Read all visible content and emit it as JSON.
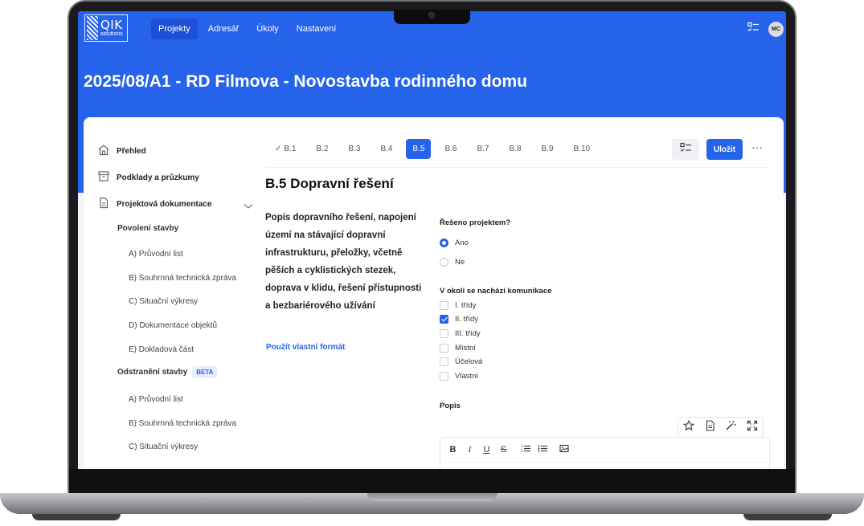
{
  "app": {
    "logo_text": "QIK",
    "logo_sub": "solutions",
    "nav": [
      "Projekty",
      "Adresář",
      "Úkoly",
      "Nastavení"
    ],
    "active_nav": "Projekty",
    "user_initials": "MC"
  },
  "page": {
    "title": "2025/08/A1 - RD Filmova - Novostavba rodinného domu"
  },
  "sidebar": {
    "overview": "Přehled",
    "docs": "Podklady a průzkumy",
    "project_docs": "Projektová dokumentace",
    "permit": "Povolení stavby",
    "permit_items": [
      "A) Průvodní list",
      "B) Souhrnná technická zpráva",
      "C) Situační výkresy",
      "D) Dokumentace objektů",
      "E) Dokladová část"
    ],
    "removal": "Odstranění stavby",
    "removal_badge": "BETA",
    "removal_items": [
      "A) Průvodní list",
      "B) Souhrnná technická zpráva",
      "C) Situační výkresy"
    ]
  },
  "tabs": {
    "items": [
      "B.1",
      "B.2",
      "B.3",
      "B.4",
      "B.5",
      "B.6",
      "B.7",
      "B.8",
      "B.9",
      "B.10"
    ],
    "completed": "B.1",
    "active": "B.5",
    "save_label": "Uložit",
    "more_label": "···"
  },
  "section": {
    "title": "B.5 Dopravní řešení",
    "description": "Popis dopravního řešení, napojení území na stávající dopravní infrastrukturu, přeložky, včetně pěších a cyklistických stezek, doprava v klidu, řešení přístupnosti a bezbariérového užívání",
    "custom_format_link": "Použít vlastní formát",
    "q1_label": "Řešeno projektem?",
    "q1_options": [
      "Ano",
      "Ne"
    ],
    "q1_selected": "Ano",
    "q2_label": "V okolí se nachází komunikace",
    "q2_options": [
      "I. třídy",
      "II. třídy",
      "III. třídy",
      "Místní",
      "Účelová",
      "Vlastní"
    ],
    "q2_checked": [
      "II. třídy"
    ],
    "description_label": "Popis"
  },
  "editor": {
    "bold": "B",
    "italic": "I",
    "underline": "U",
    "strike": "S"
  },
  "colors": {
    "primary": "#2563eb",
    "header_bg": "#2563eb"
  }
}
